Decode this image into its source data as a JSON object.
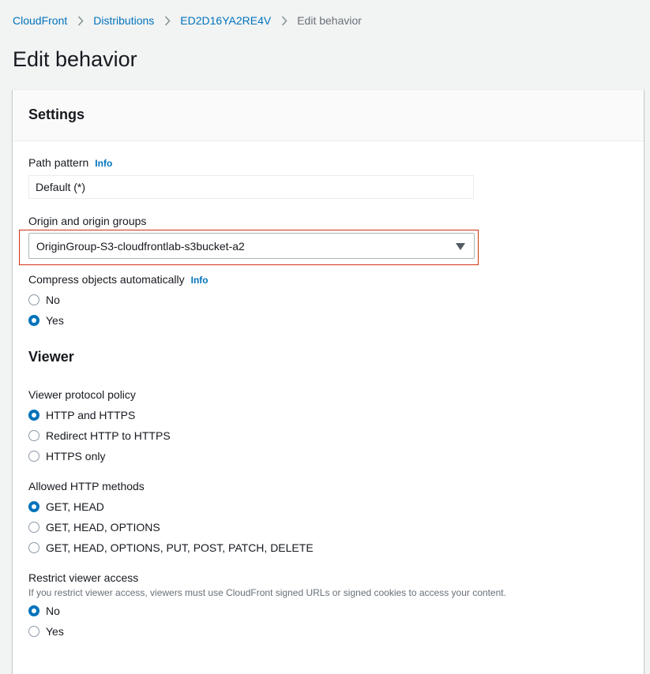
{
  "breadcrumb": {
    "items": [
      "CloudFront",
      "Distributions",
      "ED2D16YA2RE4V"
    ],
    "current": "Edit behavior"
  },
  "page_title": "Edit behavior",
  "settings": {
    "title": "Settings",
    "path_pattern": {
      "label": "Path pattern",
      "info": "Info",
      "value": "Default (*)"
    },
    "origin": {
      "label": "Origin and origin groups",
      "selected": "OriginGroup-S3-cloudfrontlab-s3bucket-a2",
      "highlight_color": "#d13212"
    },
    "compress": {
      "label": "Compress objects automatically",
      "info": "Info",
      "options": [
        "No",
        "Yes"
      ],
      "selected": "Yes"
    }
  },
  "viewer": {
    "title": "Viewer",
    "protocol_policy": {
      "label": "Viewer protocol policy",
      "options": [
        "HTTP and HTTPS",
        "Redirect HTTP to HTTPS",
        "HTTPS only"
      ],
      "selected": "HTTP and HTTPS"
    },
    "allowed_methods": {
      "label": "Allowed HTTP methods",
      "options": [
        "GET, HEAD",
        "GET, HEAD, OPTIONS",
        "GET, HEAD, OPTIONS, PUT, POST, PATCH, DELETE"
      ],
      "selected": "GET, HEAD"
    },
    "restrict_access": {
      "label": "Restrict viewer access",
      "description": "If you restrict viewer access, viewers must use CloudFront signed URLs or signed cookies to access your content.",
      "options": [
        "No",
        "Yes"
      ],
      "selected": "No"
    }
  },
  "icons": {
    "breadcrumb_separator": "chevron-right-icon",
    "select_caret": "caret-down-icon"
  },
  "colors": {
    "link": "#0073bb",
    "radio_checked": "#0073bb",
    "background": "#f2f3f3"
  }
}
